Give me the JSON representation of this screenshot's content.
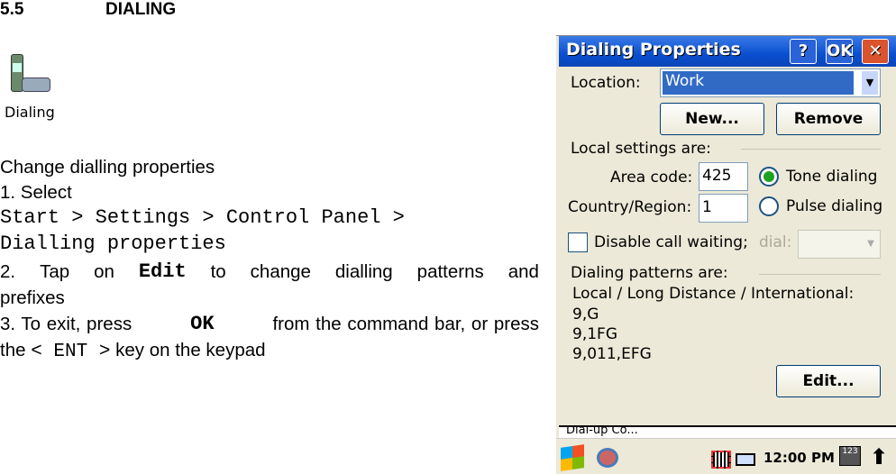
{
  "section": {
    "number": "5.5",
    "title": "DIALING"
  },
  "icon": {
    "name": "dialing-phone-icon",
    "label": "Dialing"
  },
  "body": {
    "intro": "Change dialling properties",
    "step1": "1. Select",
    "path_line1": "Start > Settings > Control Panel >",
    "path_line2": "Dialling properties",
    "step2_words": [
      "2.",
      "Tap",
      "on",
      "Edit",
      "to",
      "change",
      "dialling",
      "patterns",
      "and"
    ],
    "step2_tail": "prefixes",
    "step3_a": "3. To exit, press",
    "step3_ok": "OK",
    "step3_b": "from the command bar, or press",
    "step3_c": "the",
    "step3_key": "< ENT >",
    "step3_d": "key on the keypad"
  },
  "dialog": {
    "title": "Dialing Properties",
    "help": "?",
    "ok": "OK",
    "close": "✕",
    "location_label": "Location:",
    "location_value": "Work",
    "new_button": "New...",
    "remove_button": "Remove",
    "local_settings": "Local settings are:",
    "area_code_label": "Area code:",
    "area_code": "425",
    "country_label": "Country/Region:",
    "country": "1",
    "tone": "Tone dialing",
    "pulse": "Pulse dialing",
    "selected": "tone",
    "disable_call_waiting": "Disable call waiting;",
    "dial_label": "dial:",
    "patterns_header": "Dialing patterns are:",
    "patterns_sub": "Local / Long Distance / International:",
    "patterns": [
      "9,G",
      "9,1FG",
      "9,011,EFG"
    ],
    "edit_button": "Edit..."
  },
  "background_item": "Dial-up Co...",
  "taskbar": {
    "time": "12:00 PM"
  },
  "colors": {
    "titlebar": "#0a4fd0",
    "dialog_bg": "#ece9d8",
    "selection": "#316ac5"
  }
}
